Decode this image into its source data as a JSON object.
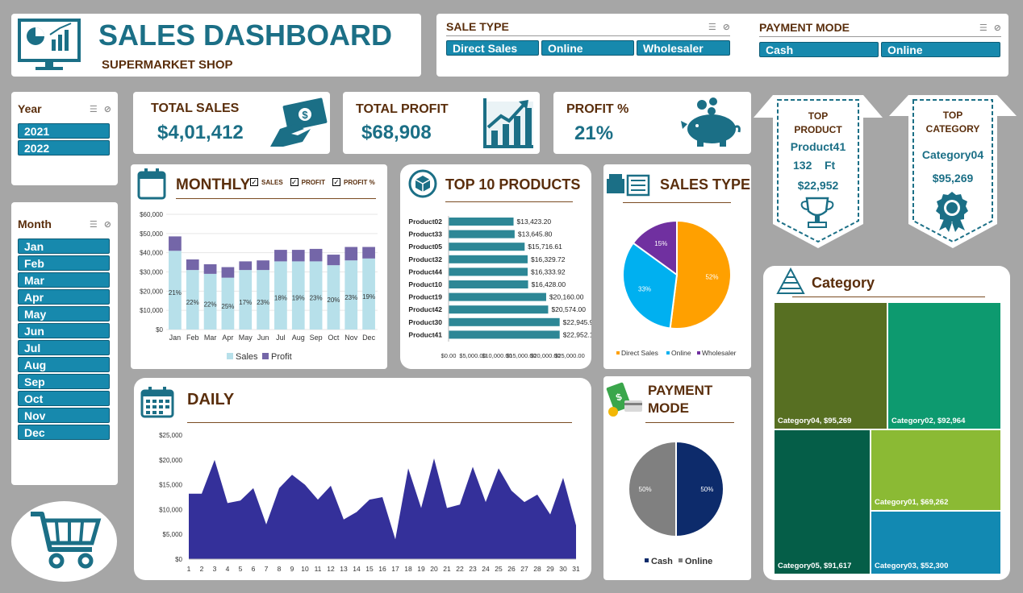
{
  "header": {
    "title": "SALES DASHBOARD",
    "subtitle": "SUPERMARKET SHOP"
  },
  "slicers": {
    "sale_type": {
      "label": "SALE TYPE",
      "items": [
        "Direct Sales",
        "Online",
        "Wholesaler"
      ]
    },
    "payment_mode": {
      "label": "PAYMENT MODE",
      "items": [
        "Cash",
        "Online"
      ]
    },
    "year": {
      "label": "Year",
      "items": [
        "2021",
        "2022"
      ]
    },
    "month": {
      "label": "Month",
      "items": [
        "Jan",
        "Feb",
        "Mar",
        "Apr",
        "May",
        "Jun",
        "Jul",
        "Aug",
        "Sep",
        "Oct",
        "Nov",
        "Dec"
      ]
    }
  },
  "kpis": {
    "total_sales": {
      "label": "TOTAL SALES",
      "value": "$4,01,412"
    },
    "total_profit": {
      "label": "TOTAL PROFIT",
      "value": "$68,908"
    },
    "profit_pct": {
      "label": "PROFIT %",
      "value": "21%"
    }
  },
  "top_product": {
    "label_line1": "TOP",
    "label_line2": "PRODUCT",
    "name": "Product41",
    "qty": "132",
    "unit": "Ft",
    "value": "$22,952"
  },
  "top_category": {
    "label_line1": "TOP",
    "label_line2": "CATEGORY",
    "name": "Category04",
    "value": "$95,269"
  },
  "monthly": {
    "title": "MONTHLY",
    "checks": [
      "SALES",
      "PROFIT",
      "PROFIT %"
    ],
    "legend": [
      "Sales",
      "Profit"
    ]
  },
  "top10": {
    "title": "TOP 10 PRODUCTS"
  },
  "sales_type_chart": {
    "title": "SALES TYPE"
  },
  "payment_chart": {
    "title_line1": "PAYMENT",
    "title_line2": "MODE"
  },
  "daily": {
    "title": "DAILY"
  },
  "category": {
    "title": "Category"
  },
  "colors": {
    "accent": "#1b6f86",
    "brown": "#5a2e0c",
    "chip": "#1789ad",
    "sales_bar": "#b7e0ea",
    "profit_bar": "#7466a8",
    "daily_area": "#34309a",
    "pie_orange": "#ffa000",
    "pie_blue": "#00b0f0",
    "pie_purple": "#7030a0",
    "navy": "#0d2b6b",
    "grey": "#808080"
  },
  "chart_data": [
    {
      "type": "bar",
      "stacked": true,
      "categories": [
        "Jan",
        "Feb",
        "Mar",
        "Apr",
        "May",
        "Jun",
        "Jul",
        "Aug",
        "Sep",
        "Oct",
        "Nov",
        "Dec"
      ],
      "series": [
        {
          "name": "Sales",
          "values": [
            41000,
            31000,
            29000,
            27000,
            31000,
            31000,
            35500,
            35500,
            35500,
            33500,
            36000,
            37000
          ]
        },
        {
          "name": "Profit",
          "values": [
            7500,
            5500,
            5000,
            5500,
            4500,
            5000,
            6000,
            6000,
            6500,
            5500,
            7000,
            6000
          ]
        }
      ],
      "data_labels": [
        "21%",
        "22%",
        "22%",
        "25%",
        "17%",
        "23%",
        "18%",
        "19%",
        "23%",
        "20%",
        "23%",
        "19%"
      ],
      "yticks": [
        "$0",
        "$10,000",
        "$20,000",
        "$30,000",
        "$40,000",
        "$50,000",
        "$60,000"
      ],
      "ylim": [
        0,
        60000
      ],
      "legend": "bottom"
    },
    {
      "type": "bar",
      "orientation": "horizontal",
      "categories": [
        "Product02",
        "Product33",
        "Product05",
        "Product32",
        "Product44",
        "Product10",
        "Product19",
        "Product42",
        "Product30",
        "Product41"
      ],
      "values": [
        13423.2,
        13645.8,
        15716.61,
        16329.72,
        16333.92,
        16428.0,
        20160.0,
        20574.0,
        22945.92,
        22952.16
      ],
      "labels": [
        "$13,423.20",
        "$13,645.80",
        "$15,716.61",
        "$16,329.72",
        "$16,333.92",
        "$16,428.00",
        "$20,160.00",
        "$20,574.00",
        "$22,945.92",
        "$22,952.16"
      ],
      "xticks": [
        "$0.00",
        "$5,000.00",
        "$10,000.00",
        "$15,000.00",
        "$20,000.00",
        "$25,000.00"
      ],
      "xlim": [
        0,
        25000
      ]
    },
    {
      "type": "pie",
      "labels": [
        "Direct Sales",
        "Online",
        "Wholesaler"
      ],
      "values": [
        52,
        33,
        15
      ],
      "data_labels": [
        "52%",
        "33%",
        "15%"
      ],
      "legend": "bottom"
    },
    {
      "type": "pie",
      "labels": [
        "Cash",
        "Online"
      ],
      "values": [
        50,
        50
      ],
      "data_labels": [
        "50%",
        "50%"
      ],
      "legend": "bottom"
    },
    {
      "type": "area",
      "x": [
        1,
        2,
        3,
        4,
        5,
        6,
        7,
        8,
        9,
        10,
        11,
        12,
        13,
        14,
        15,
        16,
        17,
        18,
        19,
        20,
        21,
        22,
        23,
        24,
        25,
        26,
        27,
        28,
        29,
        30,
        31
      ],
      "values": [
        13200,
        13200,
        20000,
        11300,
        11800,
        14300,
        7000,
        14300,
        17000,
        15000,
        12000,
        14800,
        8000,
        9500,
        12000,
        12500,
        4000,
        18300,
        10300,
        20300,
        10300,
        11000,
        18600,
        11500,
        18300,
        13800,
        11500,
        13000,
        9000,
        16400,
        6800
      ],
      "yticks": [
        "$0",
        "$5,000",
        "$10,000",
        "$15,000",
        "$20,000",
        "$25,000"
      ],
      "ylim": [
        0,
        25000
      ]
    },
    {
      "type": "treemap",
      "labels": [
        "Category04, $95,269",
        "Category02, $92,964",
        "Category01, $69,262",
        "Category05, $91,617",
        "Category03, $52,300"
      ],
      "names": [
        "Category04",
        "Category02",
        "Category01",
        "Category05",
        "Category03"
      ],
      "values": [
        95269,
        92964,
        69262,
        91617,
        52300
      ]
    }
  ]
}
